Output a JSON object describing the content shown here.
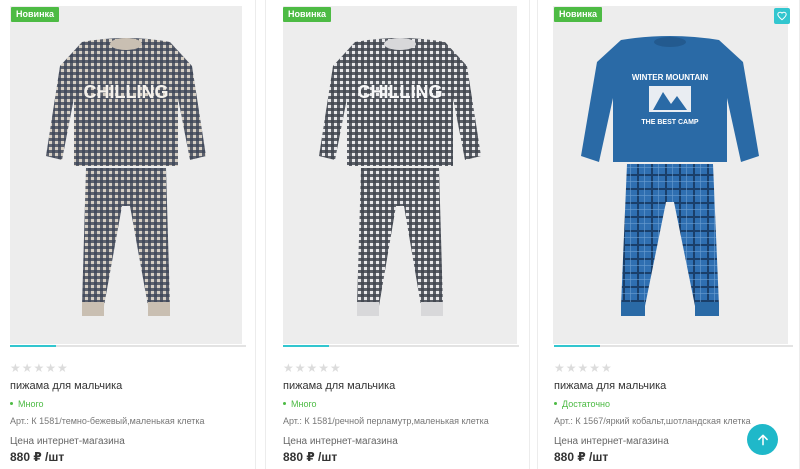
{
  "products": [
    {
      "badge": "Новинка",
      "rating_stars": "★★★★★",
      "title": "пижама для мальчика",
      "stock": "Много",
      "article": "Арт.: К 1581/темно-бежевый,маленькая клетка",
      "price_label": "Цена интернет-магазина",
      "price": "880 ₽ /шт",
      "print_text": "CHILLING",
      "colors": {
        "check_dark": "#3d4658",
        "check_light": "#d6cfc4",
        "cuff": "#c9bfb2"
      }
    },
    {
      "badge": "Новинка",
      "rating_stars": "★★★★★",
      "title": "пижама для мальчика",
      "stock": "Много",
      "article": "Арт.: К 1581/речной перламутр,маленькая клетка",
      "price_label": "Цена интернет-магазина",
      "price": "880 ₽ /шт",
      "print_text": "CHILLING",
      "colors": {
        "check_dark": "#41454f",
        "check_light": "#e8e8ea",
        "cuff": "#d8d8da"
      }
    },
    {
      "badge": "Новинка",
      "rating_stars": "★★★★★",
      "title": "пижама для мальчика",
      "stock": "Достаточно",
      "article": "Арт.: К 1567/яркий кобальт,шотландская клетка",
      "price_label": "Цена интернет-магазина",
      "price": "880 ₽ /шт",
      "print_text_top": "WINTER MOUNTAIN",
      "print_text_bottom": "THE BEST CAMP",
      "colors": {
        "top": "#2a6aa6",
        "pants": "#2f6fb1",
        "plaid": "#1a3f6a"
      }
    }
  ],
  "icons": {
    "favorite": "heart-icon",
    "scroll_top": "arrow-up-icon"
  },
  "theme": {
    "badge_green": "#4dbb44",
    "accent_teal": "#32c6cf"
  }
}
